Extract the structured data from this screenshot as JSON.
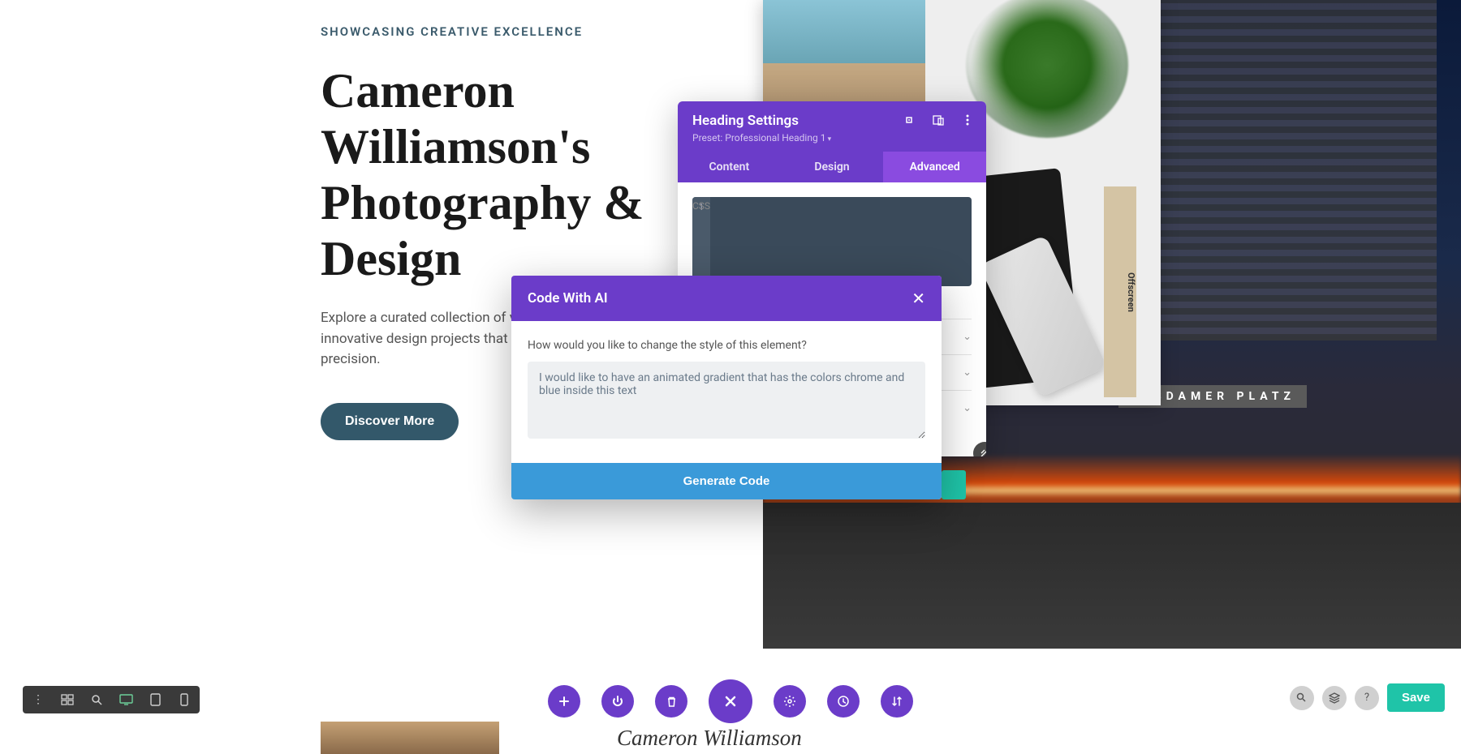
{
  "page": {
    "eyebrow": "SHOWCASING CREATIVE EXCELLENCE",
    "heading": "Cameron Williamson's Photography & Design",
    "body": "Explore a curated collection of visual storytelling and innovative design projects that blend creativity and precision.",
    "cta": "Discover More",
    "below_name": "Cameron Williamson",
    "sign_text": "OTSDAMER PLATZ",
    "mag_text": "Offscreen"
  },
  "settings": {
    "title": "Heading Settings",
    "preset": "Preset: Professional Heading 1",
    "tabs": {
      "content": "Content",
      "design": "Design",
      "advanced": "Advanced"
    },
    "css_label": "CSS",
    "line_number": "1"
  },
  "ai_modal": {
    "title": "Code With AI",
    "prompt_label": "How would you like to change the style of this element?",
    "textarea_value": "I would like to have an animated gradient that has the colors chrome and blue inside this text",
    "generate_button": "Generate Code"
  },
  "right_tools": {
    "save": "Save"
  }
}
